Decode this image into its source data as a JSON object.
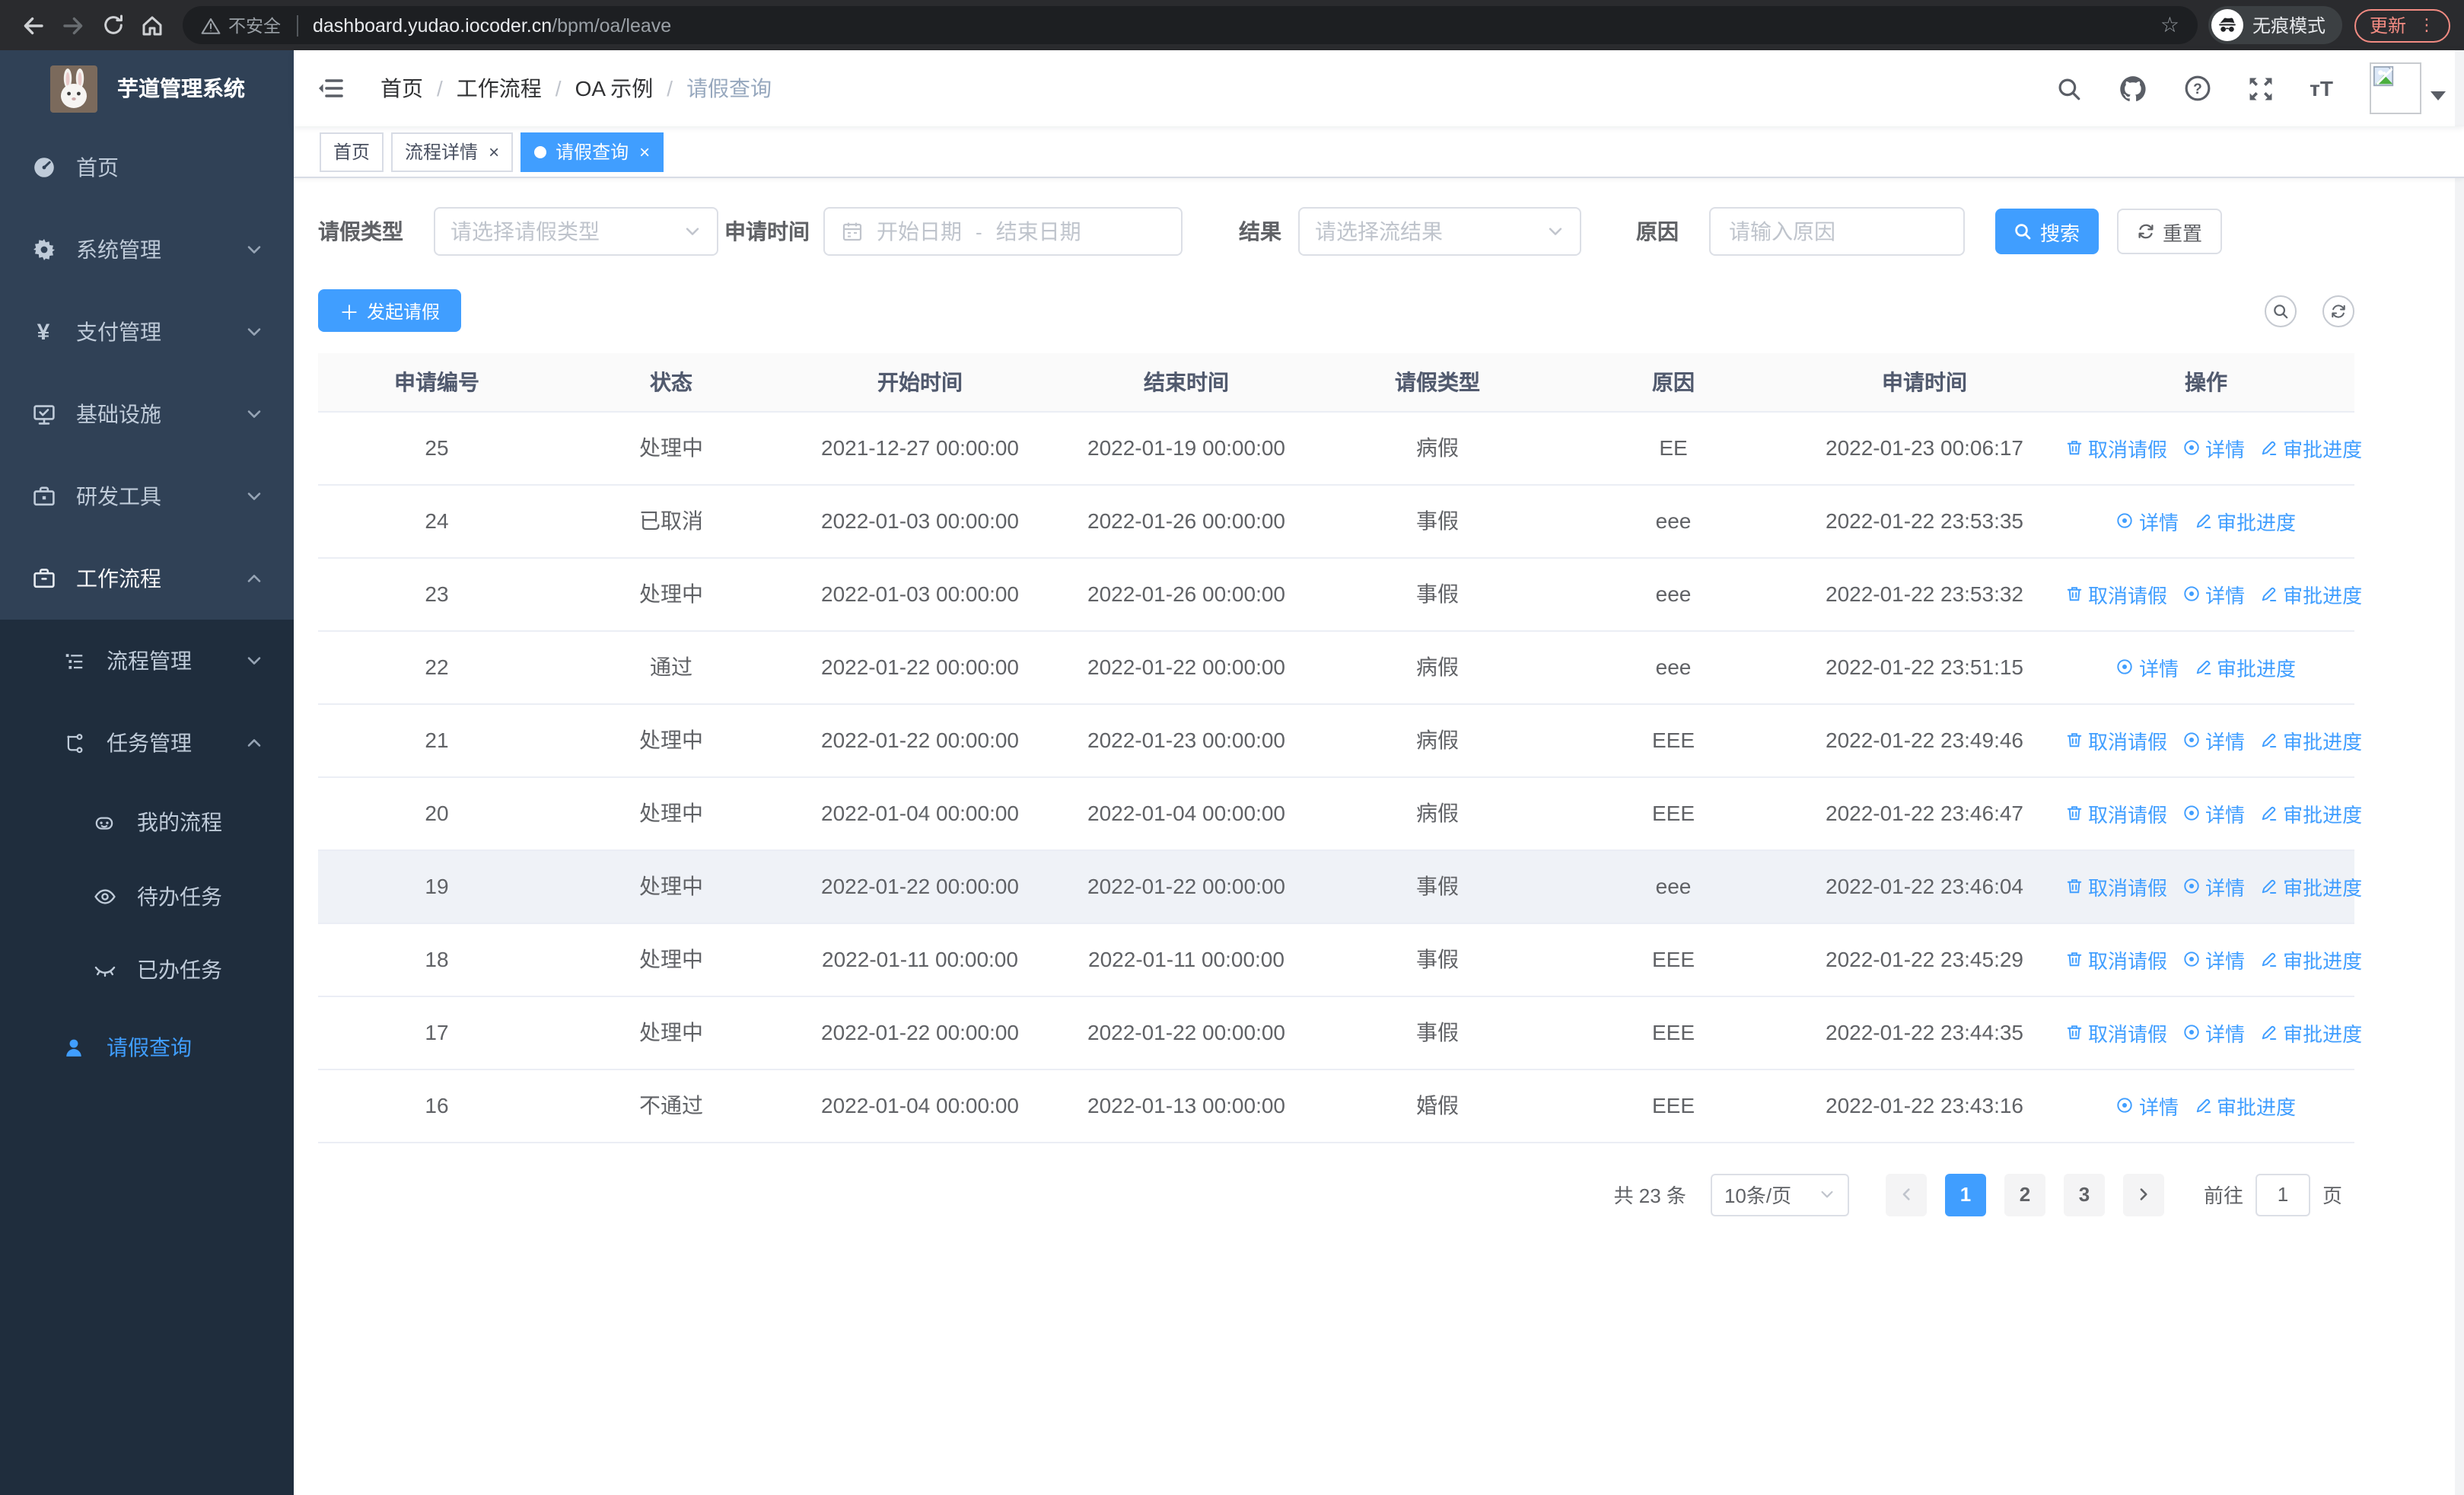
{
  "colors": {
    "primary": "#409EFF",
    "sidebar_bg": "#304156",
    "submenu_bg": "#1f2d3d",
    "update_red": "#f28b82"
  },
  "browser": {
    "security_label": "不安全",
    "url_host": "dashboard.yudao.iocoder.cn",
    "url_path": "/bpm/oa/leave",
    "incognito_label": "无痕模式",
    "update_label": "更新"
  },
  "sidebar": {
    "title": "芋道管理系统",
    "menu": [
      {
        "label": "首页"
      },
      {
        "label": "系统管理"
      },
      {
        "label": "支付管理"
      },
      {
        "label": "基础设施"
      },
      {
        "label": "研发工具"
      },
      {
        "label": "工作流程"
      },
      {
        "label": "流程管理"
      },
      {
        "label": "任务管理"
      },
      {
        "label": "我的流程"
      },
      {
        "label": "待办任务"
      },
      {
        "label": "已办任务"
      },
      {
        "label": "请假查询"
      }
    ]
  },
  "breadcrumb": {
    "items": [
      "首页",
      "工作流程",
      "OA 示例",
      "请假查询"
    ]
  },
  "tabs": [
    {
      "label": "首页"
    },
    {
      "label": "流程详情"
    },
    {
      "label": "请假查询"
    }
  ],
  "filters": {
    "leave_type": {
      "label": "请假类型",
      "placeholder": "请选择请假类型"
    },
    "apply_time": {
      "label": "申请时间",
      "start_placeholder": "开始日期",
      "separator": "-",
      "end_placeholder": "结束日期"
    },
    "result": {
      "label": "结果",
      "placeholder": "请选择流结果"
    },
    "reason": {
      "label": "原因",
      "placeholder": "请输入原因"
    },
    "search_label": "搜索",
    "reset_label": "重置"
  },
  "toolbar": {
    "create_label": "发起请假"
  },
  "table": {
    "columns": [
      "申请编号",
      "状态",
      "开始时间",
      "结束时间",
      "请假类型",
      "原因",
      "申请时间",
      "操作"
    ],
    "action_labels": {
      "cancel": "取消请假",
      "detail": "详情",
      "progress": "审批进度"
    },
    "rows": [
      {
        "id": "25",
        "status": "处理中",
        "start": "2021-12-27 00:00:00",
        "end": "2022-01-19 00:00:00",
        "type": "病假",
        "reason": "EE",
        "apply": "2022-01-23 00:06:17",
        "actions": [
          "cancel",
          "detail",
          "progress"
        ],
        "highlight": false
      },
      {
        "id": "24",
        "status": "已取消",
        "start": "2022-01-03 00:00:00",
        "end": "2022-01-26 00:00:00",
        "type": "事假",
        "reason": "eee",
        "apply": "2022-01-22 23:53:35",
        "actions": [
          "detail",
          "progress"
        ],
        "highlight": false
      },
      {
        "id": "23",
        "status": "处理中",
        "start": "2022-01-03 00:00:00",
        "end": "2022-01-26 00:00:00",
        "type": "事假",
        "reason": "eee",
        "apply": "2022-01-22 23:53:32",
        "actions": [
          "cancel",
          "detail",
          "progress"
        ],
        "highlight": false
      },
      {
        "id": "22",
        "status": "通过",
        "start": "2022-01-22 00:00:00",
        "end": "2022-01-22 00:00:00",
        "type": "病假",
        "reason": "eee",
        "apply": "2022-01-22 23:51:15",
        "actions": [
          "detail",
          "progress"
        ],
        "highlight": false
      },
      {
        "id": "21",
        "status": "处理中",
        "start": "2022-01-22 00:00:00",
        "end": "2022-01-23 00:00:00",
        "type": "病假",
        "reason": "EEE",
        "apply": "2022-01-22 23:49:46",
        "actions": [
          "cancel",
          "detail",
          "progress"
        ],
        "highlight": false
      },
      {
        "id": "20",
        "status": "处理中",
        "start": "2022-01-04 00:00:00",
        "end": "2022-01-04 00:00:00",
        "type": "病假",
        "reason": "EEE",
        "apply": "2022-01-22 23:46:47",
        "actions": [
          "cancel",
          "detail",
          "progress"
        ],
        "highlight": false
      },
      {
        "id": "19",
        "status": "处理中",
        "start": "2022-01-22 00:00:00",
        "end": "2022-01-22 00:00:00",
        "type": "事假",
        "reason": "eee",
        "apply": "2022-01-22 23:46:04",
        "actions": [
          "cancel",
          "detail",
          "progress"
        ],
        "highlight": true
      },
      {
        "id": "18",
        "status": "处理中",
        "start": "2022-01-11 00:00:00",
        "end": "2022-01-11 00:00:00",
        "type": "事假",
        "reason": "EEE",
        "apply": "2022-01-22 23:45:29",
        "actions": [
          "cancel",
          "detail",
          "progress"
        ],
        "highlight": false
      },
      {
        "id": "17",
        "status": "处理中",
        "start": "2022-01-22 00:00:00",
        "end": "2022-01-22 00:00:00",
        "type": "事假",
        "reason": "EEE",
        "apply": "2022-01-22 23:44:35",
        "actions": [
          "cancel",
          "detail",
          "progress"
        ],
        "highlight": false
      },
      {
        "id": "16",
        "status": "不通过",
        "start": "2022-01-04 00:00:00",
        "end": "2022-01-13 00:00:00",
        "type": "婚假",
        "reason": "EEE",
        "apply": "2022-01-22 23:43:16",
        "actions": [
          "detail",
          "progress"
        ],
        "highlight": false
      }
    ]
  },
  "pagination": {
    "total_label": "共 23 条",
    "page_size": "10条/页",
    "pages": [
      "1",
      "2",
      "3"
    ],
    "active_page": "1",
    "goto_label": "前往",
    "goto_value": "1",
    "goto_suffix": "页"
  }
}
